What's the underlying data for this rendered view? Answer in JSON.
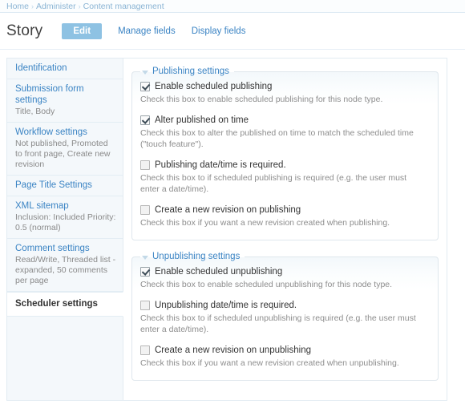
{
  "breadcrumb": {
    "separator": "›",
    "items": [
      "Home",
      "Administer",
      "Content management"
    ]
  },
  "header": {
    "title": "Story",
    "tabs": [
      {
        "label": "Edit",
        "active": true
      },
      {
        "label": "Manage fields",
        "active": false
      },
      {
        "label": "Display fields",
        "active": false
      }
    ]
  },
  "vertical_tabs": [
    {
      "title": "Identification",
      "summary": "",
      "selected": false
    },
    {
      "title": "Submission form settings",
      "summary": "Title, Body",
      "selected": false
    },
    {
      "title": "Workflow settings",
      "summary": "Not published, Promoted to front page, Create new revision",
      "selected": false
    },
    {
      "title": "Page Title Settings",
      "summary": "",
      "selected": false
    },
    {
      "title": "XML sitemap",
      "summary": "Inclusion: Included Priority: 0.5 (normal)",
      "selected": false
    },
    {
      "title": "Comment settings",
      "summary": "Read/Write, Threaded list - expanded, 50 comments per page",
      "selected": false
    },
    {
      "title": "Scheduler settings",
      "summary": "",
      "selected": true
    }
  ],
  "panels": [
    {
      "legend": "Publishing settings",
      "items": [
        {
          "label": "Enable scheduled publishing",
          "checked": true,
          "description": "Check this box to enable scheduled publishing for this node type."
        },
        {
          "label": "Alter published on time",
          "checked": true,
          "description": "Check this box to alter the published on time to match the scheduled time (\"touch feature\")."
        },
        {
          "label": "Publishing date/time is required.",
          "checked": false,
          "description": "Check this box to if scheduled publishing is required (e.g. the user must enter a date/time)."
        },
        {
          "label": "Create a new revision on publishing",
          "checked": false,
          "description": "Check this box if you want a new revision created when publishing."
        }
      ]
    },
    {
      "legend": "Unpublishing settings",
      "items": [
        {
          "label": "Enable scheduled unpublishing",
          "checked": true,
          "description": "Check this box to enable scheduled unpublishing for this node type."
        },
        {
          "label": "Unpublishing date/time is required.",
          "checked": false,
          "description": "Check this box to if scheduled unpublishing is required (e.g. the user must enter a date/time)."
        },
        {
          "label": "Create a new revision on unpublishing",
          "checked": false,
          "description": "Check this box if you want a new revision created when unpublishing."
        }
      ]
    }
  ],
  "colors": {
    "link": "#3b84c4",
    "active_tab_bg": "#8ec2e3",
    "panel_border": "#dfe7ed",
    "sidebar_bg": "#f4f8fb",
    "description_text": "#8d8d8d"
  }
}
